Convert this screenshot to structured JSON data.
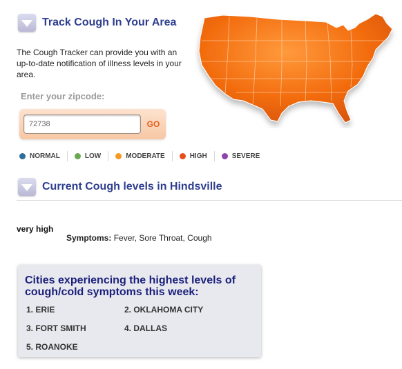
{
  "track": {
    "title": "Track Cough In Your Area",
    "intro": "The Cough Tracker can provide you with an up-to-date notification of illness levels in your area.",
    "zip_label": "Enter your zipcode:",
    "zip_value": "72738",
    "go_label": "GO"
  },
  "legend": [
    {
      "label": "NORMAL",
      "color": "#2d6e9b"
    },
    {
      "label": "LOW",
      "color": "#6aa84f"
    },
    {
      "label": "MODERATE",
      "color": "#f39a22"
    },
    {
      "label": "HIGH",
      "color": "#e84e1b"
    },
    {
      "label": "SEVERE",
      "color": "#8e44ad"
    }
  ],
  "current": {
    "title": "Current Cough levels in Hindsville",
    "level": "very high",
    "symptoms_label": "Symptoms:",
    "symptoms_value": "Fever, Sore Throat, Cough"
  },
  "cities": {
    "title": "Cities experiencing the highest levels of cough/cold symptoms this week:",
    "items": [
      "1.  ERIE",
      "2.  OKLAHOMA CITY",
      "3.  FORT SMITH",
      "4.  DALLAS",
      "5.  ROANOKE"
    ]
  },
  "colors": {
    "accent": "#2e3d8f",
    "map": "#f36d0f"
  }
}
